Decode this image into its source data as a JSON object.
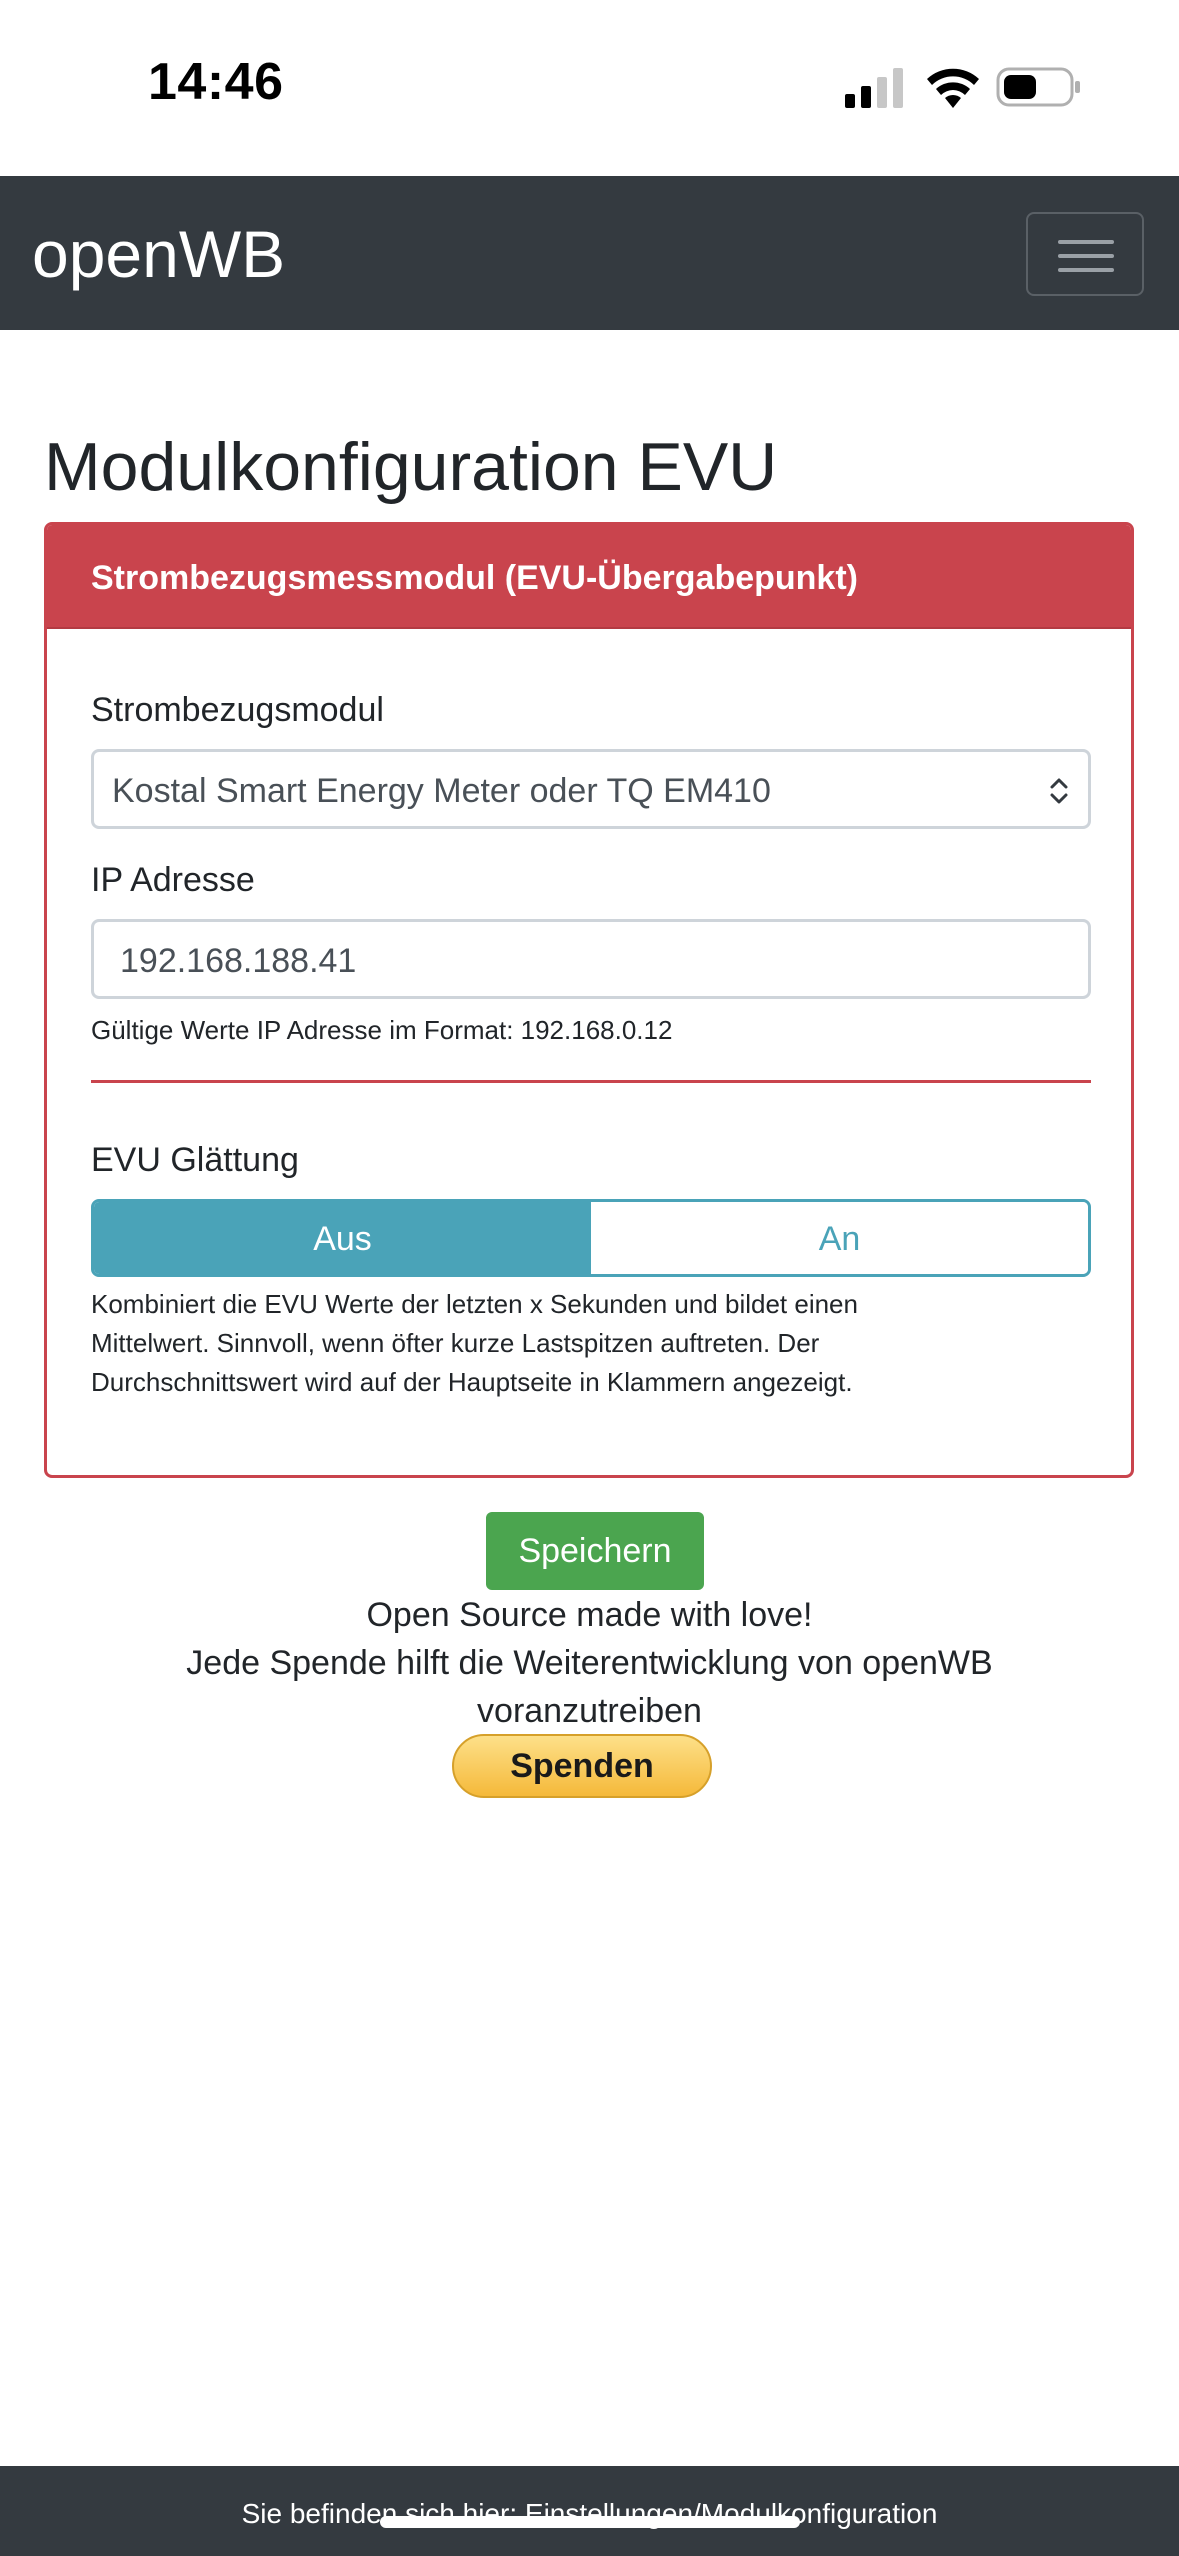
{
  "status_bar": {
    "time": "14:46"
  },
  "navbar": {
    "brand": "openWB",
    "menu_icon": "hamburger-menu-icon"
  },
  "page": {
    "title": "Modulkonfiguration EVU"
  },
  "card": {
    "header": "Strombezugsmessmodul (EVU-Übergabepunkt)",
    "module_label": "Strombezugsmodul",
    "module_selected": "Kostal Smart Energy Meter oder TQ EM410",
    "ip_label": "IP Adresse",
    "ip_value": "192.168.188.41",
    "ip_help": "Gültige Werte IP Adresse im Format: 192.168.0.12",
    "smoothing_label": "EVU Glättung",
    "smoothing_off": "Aus",
    "smoothing_on": "An",
    "smoothing_selected": "Aus",
    "smoothing_help_1": "Kombiniert die EVU Werte der letzten x Sekunden und bildet einen",
    "smoothing_help_2": "Mittelwert. Sinnvoll, wenn öfter kurze Lastspitzen auftreten. Der",
    "smoothing_help_3": "Durchschnittswert wird auf der Hauptseite in Klammern angezeigt."
  },
  "actions": {
    "save_label": "Speichern"
  },
  "footer": {
    "line1": "Open Source made with love!",
    "line2": "Jede Spende hilft die Weiterentwicklung von openWB",
    "line3": "voranzutreiben",
    "donate_label": "Spenden",
    "breadcrumb": "Sie befinden sich hier: Einstellungen/Modulkonfiguration"
  },
  "colors": {
    "navbar": "#343a40",
    "card_accent": "#c9444d",
    "toggle_accent": "#4aa3b8",
    "save_button": "#4ba54f"
  }
}
